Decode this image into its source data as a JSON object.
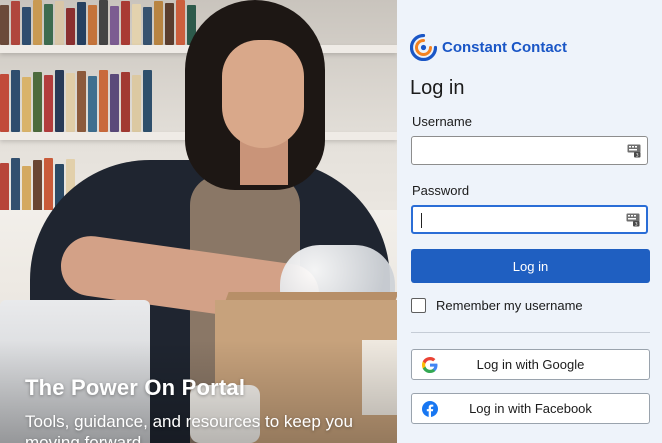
{
  "hero": {
    "title": "The Power On Portal",
    "subtitle": "Tools, guidance, and resources to keep you moving forward"
  },
  "brand": {
    "name": "Constant Contact",
    "color": "#1a56c6",
    "accent_orange": "#f58220"
  },
  "login": {
    "title": "Log in",
    "username_label": "Username",
    "username_value": "",
    "password_label": "Password",
    "password_value": "",
    "submit_label": "Log in",
    "remember_label": "Remember my username",
    "remember_checked": false
  },
  "social": {
    "google_label": "Log in with Google",
    "facebook_label": "Log in with Facebook",
    "google_icon": "google-icon",
    "facebook_icon": "facebook-icon"
  },
  "colors": {
    "panel_bg": "#eef3fa",
    "primary_button": "#1f5fc1",
    "focus_border": "#2a6dd6"
  }
}
